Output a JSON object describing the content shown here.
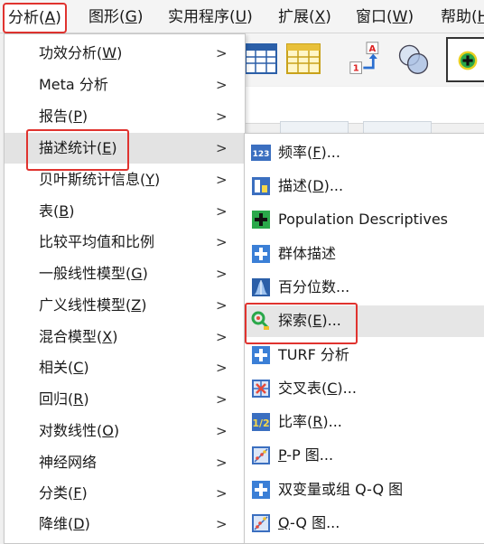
{
  "menubar": {
    "items": [
      {
        "label": "分析(A)",
        "active": true
      },
      {
        "label": "图形(G)"
      },
      {
        "label": "实用程序(U)"
      },
      {
        "label": "扩展(X)"
      },
      {
        "label": "窗口(W)"
      },
      {
        "label": "帮助(H"
      }
    ]
  },
  "background": {
    "toolbar_icons": [
      "table-icon",
      "grid-table-icon",
      "goto-case-icon",
      "venn-icon",
      "add-icon"
    ]
  },
  "analyze_menu": {
    "items": [
      {
        "label": "功效分析(W)",
        "submenu": true
      },
      {
        "label": "Meta 分析",
        "submenu": true
      },
      {
        "label": "报告(P)",
        "submenu": true
      },
      {
        "label": "描述统计(E)",
        "submenu": true,
        "highlighted": true
      },
      {
        "label": "贝叶斯统计信息(Y)",
        "submenu": true
      },
      {
        "label": "表(B)",
        "submenu": true
      },
      {
        "label": "比较平均值和比例",
        "submenu": true
      },
      {
        "label": "一般线性模型(G)",
        "submenu": true
      },
      {
        "label": "广义线性模型(Z)",
        "submenu": true
      },
      {
        "label": "混合模型(X)",
        "submenu": true
      },
      {
        "label": "相关(C)",
        "submenu": true
      },
      {
        "label": "回归(R)",
        "submenu": true
      },
      {
        "label": "对数线性(O)",
        "submenu": true
      },
      {
        "label": "神经网络",
        "submenu": true
      },
      {
        "label": "分类(F)",
        "submenu": true
      },
      {
        "label": "降维(D)",
        "submenu": true
      }
    ],
    "arrow": ">"
  },
  "descriptive_menu": {
    "items": [
      {
        "label": "频率(F)...",
        "icon": "frequencies-icon"
      },
      {
        "label": "描述(D)...",
        "icon": "descriptives-icon"
      },
      {
        "label": "Population Descriptives",
        "icon": "plus-icon"
      },
      {
        "label": "群体描述",
        "icon": "plus-icon"
      },
      {
        "label": "百分位数...",
        "icon": "percentile-icon"
      },
      {
        "label": "探索(E)...",
        "icon": "explore-icon",
        "highlighted": true
      },
      {
        "label": "TURF 分析",
        "icon": "plus-icon"
      },
      {
        "label": "交叉表(C)...",
        "icon": "crosstabs-icon"
      },
      {
        "label": "比率(R)...",
        "icon": "ratio-icon"
      },
      {
        "label": "P-P 图...",
        "icon": "pp-plot-icon"
      },
      {
        "label": "双变量或组 Q-Q 图",
        "icon": "plus-icon"
      },
      {
        "label": "Q-Q 图...",
        "icon": "qq-plot-icon"
      }
    ]
  },
  "colors": {
    "highlight_border": "#e0332f",
    "plus_icon_blue": "#3b7fd6",
    "plus_icon_green": "#2aa84a"
  }
}
